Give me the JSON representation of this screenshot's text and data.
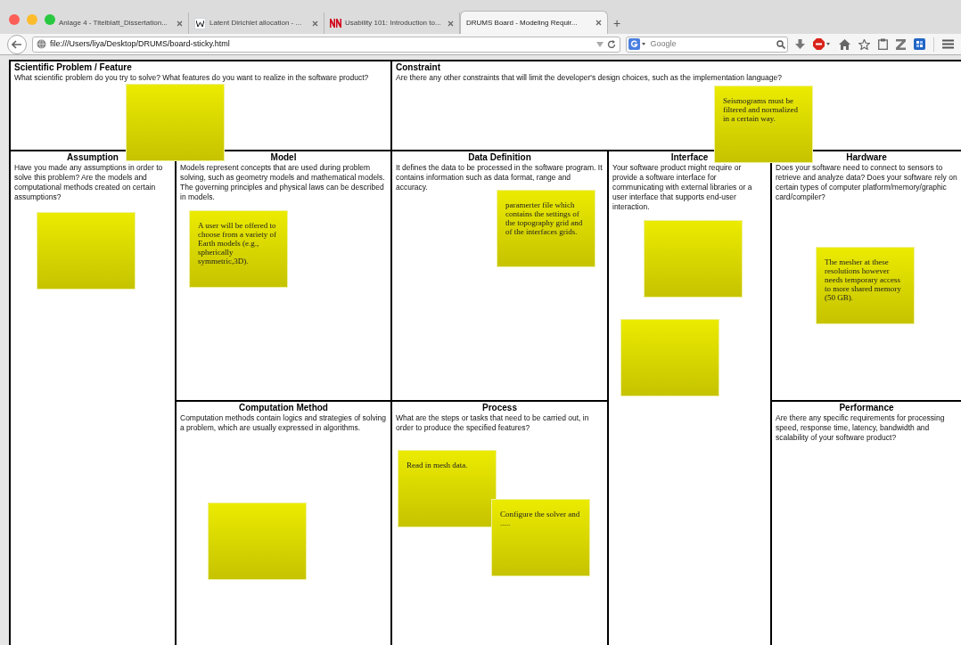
{
  "tabs": [
    {
      "label": "Anlage 4 - Titelblatt_Dissertation...",
      "selected": false
    },
    {
      "label": "Latent Dirichlet allocation - ...",
      "selected": false
    },
    {
      "label": "Usability 101: Introduction to...",
      "selected": false
    },
    {
      "label": "DRUMS Board - Modeling Requir...",
      "selected": true
    }
  ],
  "new_tab": "+",
  "address": "file:///Users/liya/Desktop/DRUMS/board-sticky.html",
  "search": {
    "placeholder": "Google"
  },
  "sections": [
    {
      "title": "Scientific Problem / Feature",
      "description": "What scientific problem do you try to solve? What features do you want to realize in the software product?"
    },
    {
      "title": "Constraint",
      "description": "Are there any other constraints that will limit the developer's design choices, such as the implementation language?"
    },
    {
      "title": "Assumption",
      "description": "Have you made any assumptions in order to solve this problem? Are the models and computational methods created on certain assumptions?"
    },
    {
      "title": "Model",
      "description": "Models represent concepts that are used during problem solving, such as geometry models and mathematical models. The governing principles and physical laws can be described in models."
    },
    {
      "title": "Data Definition",
      "description": "It defines the data to be processed in the software program. It contains information such as data format, range and accuracy."
    },
    {
      "title": "Interface",
      "description": "Your software product might require or provide a software interface for communicating with external libraries or a user interface that supports end-user interaction."
    },
    {
      "title": "Hardware",
      "description": "Does your software need to connect to sensors to retrieve and analyze data? Does your software rely on certain types of computer platform/memory/graphic card/compiler?"
    },
    {
      "title": "Computation Method",
      "description": "Computation methods contain logics and strategies of solving a problem, which are usually expressed in algorithms."
    },
    {
      "title": "Process",
      "description": "What are the steps or tasks that need to be carried out, in order to produce the specified features?"
    },
    {
      "title": "Performance",
      "description": "Are there any specific requirements for processing speed, response time, latency, bandwidth and scalability of your software product?"
    }
  ],
  "sticky_notes": [
    {
      "kind": "blank"
    },
    {
      "kind": "text",
      "text": "Seismograms must be filtered and normalized in a certain way."
    },
    {
      "kind": "blank"
    },
    {
      "kind": "text",
      "text": "A user will be offered to choose from a variety of Earth models (e.g., spherically symmetric,3D)."
    },
    {
      "kind": "text",
      "text": "paramerter file which contains the settings of the topography grid and of the interfaces grids."
    },
    {
      "kind": "blank"
    },
    {
      "kind": "blank"
    },
    {
      "kind": "text",
      "text": "The mesher at these resolutions however needs temporary access to more shared memory (50 GB)."
    },
    {
      "kind": "blank"
    },
    {
      "kind": "text",
      "text": "Read in mesh data."
    },
    {
      "kind": "text",
      "text": "Configure the solver and ....."
    }
  ]
}
